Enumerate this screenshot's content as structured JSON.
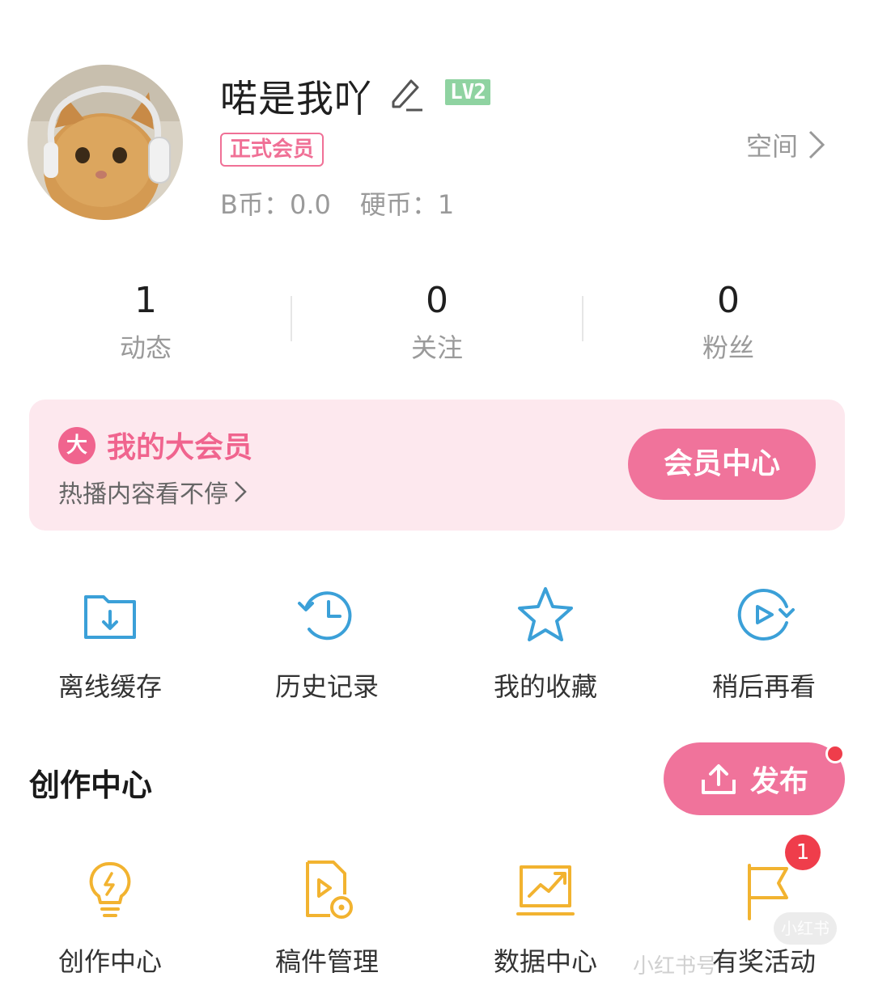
{
  "profile": {
    "username": "喏是我吖",
    "level_badge": "LV2",
    "vip_tag": "正式会员",
    "space_link": "空间",
    "b_coins": "B币：0.0",
    "coins": "硬币：1"
  },
  "stats": [
    {
      "value": "1",
      "label": "动态"
    },
    {
      "value": "0",
      "label": "关注"
    },
    {
      "value": "0",
      "label": "粉丝"
    }
  ],
  "vip_card": {
    "logo": "大",
    "title": "我的大会员",
    "subtitle": "热播内容看不停",
    "button": "会员中心"
  },
  "shortcuts": [
    {
      "label": "离线缓存",
      "icon": "offline-download-icon"
    },
    {
      "label": "历史记录",
      "icon": "history-icon"
    },
    {
      "label": "我的收藏",
      "icon": "star-icon"
    },
    {
      "label": "稍后再看",
      "icon": "watch-later-icon"
    }
  ],
  "creator": {
    "title": "创作中心",
    "publish_button": "发布",
    "items": [
      {
        "label": "创作中心",
        "icon": "lightbulb-icon"
      },
      {
        "label": "稿件管理",
        "icon": "manuscript-icon"
      },
      {
        "label": "数据中心",
        "icon": "data-chart-icon"
      },
      {
        "label": "有奖活动",
        "icon": "flag-icon"
      }
    ],
    "activity_badge": "1"
  },
  "watermark": {
    "text": "小红书号",
    "logo": "小红书"
  },
  "colors": {
    "accent_pink": "#f0739b",
    "vip_background": "#fde8ee",
    "blue_icon": "#3ba0d8",
    "yellow_icon": "#f2b330",
    "badge_red": "#ef3d4b",
    "level_green": "#8fd3a1"
  }
}
